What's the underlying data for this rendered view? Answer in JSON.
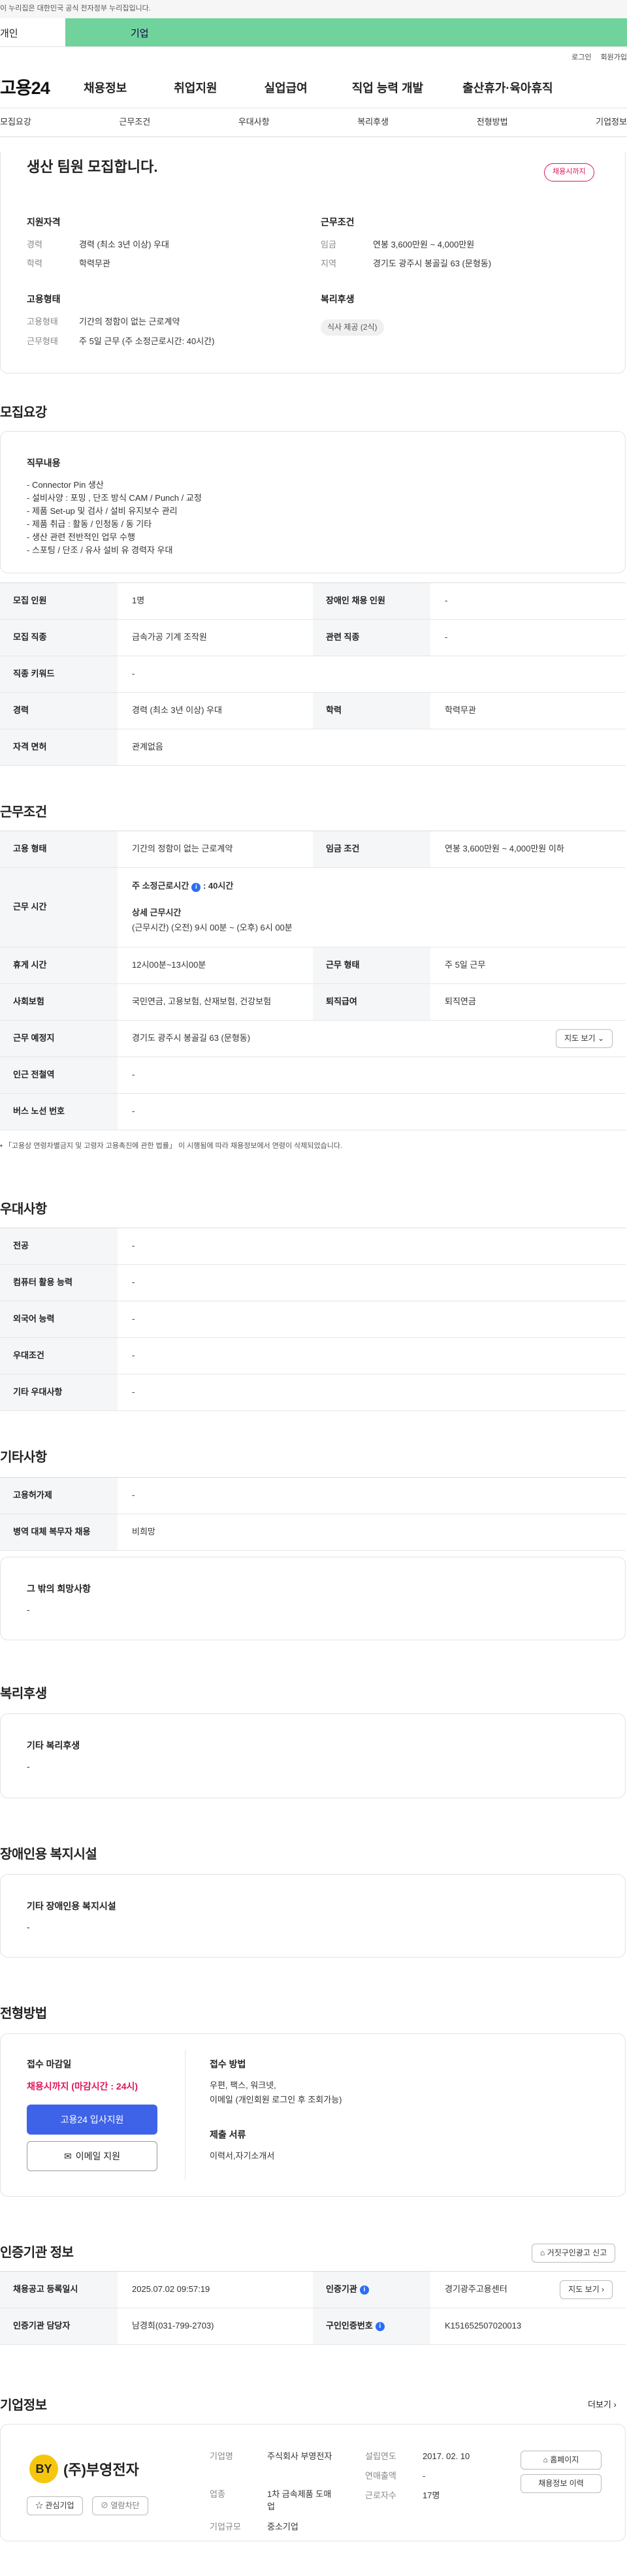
{
  "gov_banner": "이 누리집은 대한민국 공식 전자정부 누리집입니다.",
  "top_tabs": [
    "개인",
    "기업"
  ],
  "utility": [
    "로그인",
    "회원가입"
  ],
  "logo": "고용24",
  "gnb": [
    "채용정보",
    "취업지원",
    "실업급여",
    "직업 능력 개발",
    "출산휴가·육아휴직"
  ],
  "subnav": [
    "모집요강",
    "근무조건",
    "우대사항",
    "복리후생",
    "전형방법",
    "기업정보"
  ],
  "summary": {
    "title": "생산 팀원 모집합니다.",
    "badge": "채용시까지",
    "qual_h": "지원자격",
    "qual": [
      {
        "k": "경력",
        "v": "경력 (최소 3년 이상) 우대"
      },
      {
        "k": "학력",
        "v": "학력무관"
      }
    ],
    "emp_h": "고용형태",
    "emp": [
      {
        "k": "고용형태",
        "v": "기간의 정함이 없는 근로계약"
      },
      {
        "k": "근무형태",
        "v": "주 5일 근무 (주 소정근로시간: 40시간)"
      }
    ],
    "cond_h": "근무조건",
    "cond": [
      {
        "k": "임금",
        "v": "연봉 3,600만원 ~ 4,000만원"
      },
      {
        "k": "지역",
        "v": "경기도 광주시 봉골길 63 (문형동)"
      }
    ],
    "welfare_h": "복리후생",
    "welfare_chip": "식사 제공 (2식)"
  },
  "recruit": {
    "title": "모집요강",
    "duty_h": "직무내용",
    "duty_lines": [
      "- Connector Pin 생산",
      "- 설비사양 : 포밍 , 단조 방식 CAM / Punch / 교정",
      "- 제품 Set-up 및 검사 / 설비 유지보수 관리",
      "- 제품 취급 : 활동 / 인청동 / 동 기타",
      "- 생산 관련 전반적인 업무 수행",
      "- 스포팅 / 단조 / 유사 설비 유 경력자 우대"
    ],
    "rows": [
      {
        "k1": "모집 인원",
        "v1": "1명",
        "k2": "장애인 채용 인원",
        "v2": "-"
      },
      {
        "k1": "모집 직종",
        "v1": "금속가공 기계 조작원",
        "k2": "관련 직종",
        "v2": "-"
      },
      {
        "k1": "직종 키워드",
        "v1": "-"
      },
      {
        "k1": "경력",
        "v1": "경력 (최소 3년 이상) 우대",
        "k2": "학력",
        "v2": "학력무관"
      },
      {
        "k1": "자격 면허",
        "v1": "관계없음"
      }
    ]
  },
  "work": {
    "title": "근무조건",
    "type_k": "고용 형태",
    "type_v": "기간의 정함이 없는 근로계약",
    "wage_k": "임금 조건",
    "wage_v": "연봉 3,600만원 ~ 4,000만원 이하",
    "time_k": "근무 시간",
    "time_h1": "주 소정근로시간",
    "time_h1_icon": "i",
    "time_h1_v": ": 40시간",
    "time_h2": "상세 근무시간",
    "time_v2": "(근무시간) (오전) 9시 00분 ~ (오후) 6시 00분",
    "break_k": "휴게 시간",
    "break_v": "12시00분~13시00분",
    "form_k": "근무 형태",
    "form_v": "주 5일 근무",
    "ins_k": "사회보험",
    "ins_v": "국민연금, 고용보험, 산재보험, 건강보험",
    "ret_k": "퇴직급여",
    "ret_v": "퇴직연금",
    "place_k": "근무 예정지",
    "place_v": "경기도 광주시 봉골길 63 (문형동)",
    "map_btn": "지도 보기",
    "metro_k": "인근 전철역",
    "metro_v": "-",
    "bus_k": "버스 노선 번호",
    "bus_v": "-",
    "note": "「고용상 연령차별금지 및 고령자 고용촉진에 관한 법률」 이 시행됨에 따라 채용정보에서 연령이 삭제되었습니다."
  },
  "pref": {
    "title": "우대사항",
    "rows": [
      {
        "k": "전공",
        "v": "-"
      },
      {
        "k": "컴퓨터 활용 능력",
        "v": "-"
      },
      {
        "k": "외국어 능력",
        "v": "-"
      },
      {
        "k": "우대조건",
        "v": "-"
      },
      {
        "k": "기타 우대사항",
        "v": "-"
      }
    ]
  },
  "etc": {
    "title": "기타사항",
    "rows": [
      {
        "k": "고용허가제",
        "v": "-"
      },
      {
        "k": "병역 대체 복무자 채용",
        "v": "비희망"
      }
    ],
    "box_h": "그 밖의 희망사항",
    "box_v": "-"
  },
  "welfare": {
    "title": "복리후생",
    "box_h": "기타 복리후생",
    "box_v": "-"
  },
  "disabled": {
    "title": "장애인용 복지시설",
    "box_h": "기타 장애인용 복지시설",
    "box_v": "-"
  },
  "screen": {
    "title": "전형방법",
    "deadline_h": "접수 마감일",
    "deadline_v": "채용시까지 (마감시간 : 24시)",
    "apply_btn": "고용24 입사지원",
    "email_btn": "이메일 지원",
    "method_h": "접수 방법",
    "method_v1": "우편, 팩스, 워크넷,",
    "method_v2": "이메일 (개인회원 로그인 후 조회가능)",
    "docs_h": "제출 서류",
    "docs_v": "이력서,자기소개서"
  },
  "auth": {
    "title": "인증기관 정보",
    "report_btn": "거짓구인광고 신고",
    "reg_k": "채용공고 등록일시",
    "reg_v": "2025.07.02 09:57:19",
    "org_k": "인증기관",
    "org_v": "경기광주고용센터",
    "map_btn": "지도 보기",
    "mgr_k": "인증기관 담당자",
    "mgr_v": "남경희(031-799-2703)",
    "no_k": "구인인증번호",
    "no_v": "K151652507020013"
  },
  "company": {
    "title": "기업정보",
    "more": "더보기",
    "logo_text": "BY",
    "name": "(주)부영전자",
    "fav": "관심기업",
    "block": "열람차단",
    "f_name_k": "기업명",
    "f_name_v": "주식회사 부영전자",
    "f_ind_k": "업종",
    "f_ind_v": "1차 금속제품 도매업",
    "f_size_k": "기업규모",
    "f_size_v": "중소기업",
    "f_est_k": "설립연도",
    "f_est_v": "2017. 02. 10",
    "f_sales_k": "연매출액",
    "f_sales_v": "-",
    "f_emp_k": "근로자수",
    "f_emp_v": "17명",
    "homepage_btn": "홈페이지",
    "history_btn": "채용정보 이력"
  }
}
